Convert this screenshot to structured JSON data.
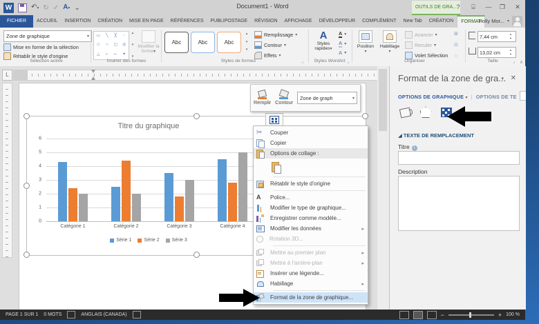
{
  "window": {
    "title": "Document1 - Word",
    "contextual_group": "OUTILS DE GRA...",
    "account": "Holly Mor..."
  },
  "icons": {
    "help": "?",
    "close": "✕",
    "minimize": "—",
    "restore": "❐",
    "ribbon_display": "⌸",
    "undo": "↶",
    "redo": "↻",
    "check": "✓",
    "az": "A",
    "more": "⌄",
    "down": "▾",
    "up": "▴",
    "submenu": "▸",
    "collapse": "∧",
    "scissors": "✂",
    "section_triangle": "◢",
    "info": "i",
    "ruler_tab": "L"
  },
  "tabs": [
    "FICHIER",
    "ACCUEIL",
    "INSERTION",
    "CRÉATION",
    "MISE EN PAGE",
    "RÉFÉRENCES",
    "PUBLIPOSTAGE",
    "RÉVISION",
    "AFFICHAGE",
    "DÉVELOPPEUR",
    "COMPLÉMENT",
    "New Tab",
    "CRÉATION",
    "FORMAT"
  ],
  "ribbon": {
    "selection": {
      "combo": "Zone de graphique",
      "format_selection": "Mise en forme de la sélection",
      "reset_style": "Rétablir le style d'origine",
      "group": "Sélection active"
    },
    "shapes": {
      "modify_shape": "Modifier la forme",
      "group": "Insérer des formes"
    },
    "shape_styles": {
      "sample": "Abc",
      "fill": "Remplissage",
      "outline": "Contour",
      "effects": "Effets",
      "group": "Styles de formes"
    },
    "wordart": {
      "quick_styles_1": "Styles",
      "quick_styles_2": "rapides",
      "group": "Styles WordArt"
    },
    "organize": {
      "position": "Position",
      "wrap": "Habillage",
      "forward": "Avancer",
      "backward": "Reculer",
      "selection_pane": "Volet Sélection",
      "group": "Organiser"
    },
    "size": {
      "height": "7,44 cm",
      "width": "13,02 cm",
      "group": "Taille"
    }
  },
  "mini_toolbar": {
    "fill": "Remplir",
    "outline": "Contour",
    "combo": "Zone de graph"
  },
  "context_menu": {
    "items": [
      {
        "label": "Couper"
      },
      {
        "label": "Copier"
      },
      {
        "label": "Options de collage :",
        "hover": true
      },
      {
        "label": "Rétablir le style d'origine"
      },
      {
        "label": "Police..."
      },
      {
        "label": "Modifier le type de graphique..."
      },
      {
        "label": "Enregistrer comme modèle..."
      },
      {
        "label": "Modifier les données",
        "submenu": true
      },
      {
        "label": "Rotation 3D...",
        "disabled": true
      },
      {
        "label": "Mettre au premier plan",
        "disabled": true,
        "submenu": true
      },
      {
        "label": "Mettre à l'arrière-plan",
        "disabled": true,
        "submenu": true
      },
      {
        "label": "Insérer une légende..."
      },
      {
        "label": "Habillage",
        "submenu": true
      },
      {
        "label": "Format de la zone de graphique...",
        "selected": true
      }
    ]
  },
  "panel": {
    "title": "Format de la zone de gra...",
    "tab_chart_options": "OPTIONS DE GRAPHIQUE",
    "tab_text_options": "OPTIONS DE TE",
    "section": "TEXTE DE REMPLACEMENT",
    "title_label": "Titre",
    "title_value": "",
    "description_label": "Description",
    "description_value": ""
  },
  "status": {
    "page": "PAGE 1 SUR 1",
    "words": "0 MOTS",
    "language": "ANGLAIS (CANADA)",
    "zoom": "100 %"
  },
  "chart_data": {
    "type": "bar",
    "title": "Titre du graphique",
    "categories": [
      "Catégorie 1",
      "Catégorie 2",
      "Catégorie 3",
      "Catégorie 4"
    ],
    "series": [
      {
        "name": "Série 1",
        "values": [
          4.3,
          2.5,
          3.5,
          4.5
        ]
      },
      {
        "name": "Série 2",
        "values": [
          2.4,
          4.4,
          1.8,
          2.8
        ]
      },
      {
        "name": "Série 3",
        "values": [
          2.0,
          2.0,
          3.0,
          5.0
        ]
      }
    ],
    "colors": [
      "#5b9bd5",
      "#ed7d31",
      "#a5a5a5"
    ],
    "ylim": [
      0,
      6
    ],
    "ytick_step": 1,
    "gridlines": true,
    "legend_position": "bottom"
  }
}
